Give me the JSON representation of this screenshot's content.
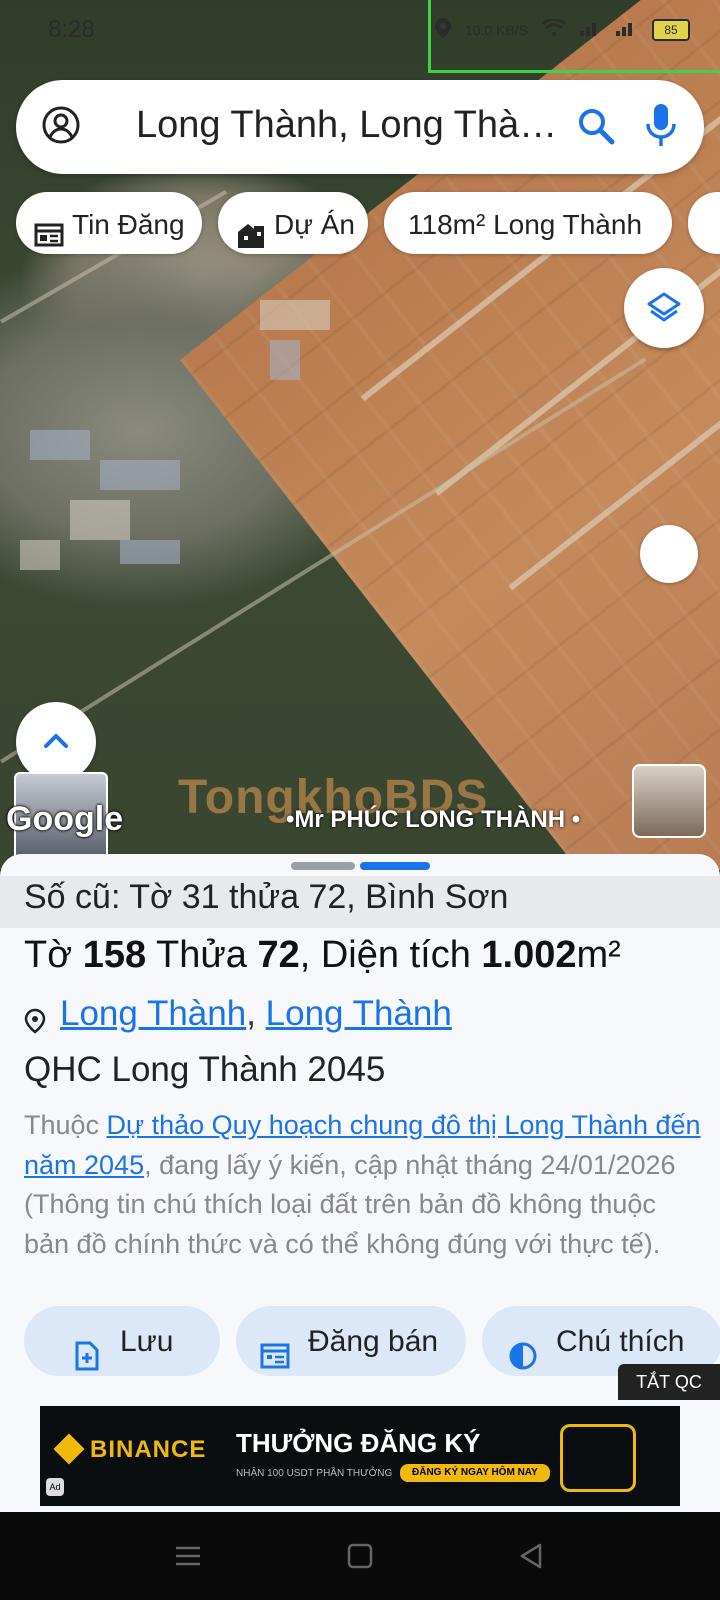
{
  "status": {
    "time": "8:28",
    "speed": "10.0 KB/S",
    "battery": "85"
  },
  "search": {
    "value": "Long Thành, Long Thà…"
  },
  "chips": [
    {
      "label": "Tin Đăng",
      "icon": "news-icon"
    },
    {
      "label": "Dự Án",
      "icon": "building-icon"
    },
    {
      "label": "118m² Long Thành",
      "icon": ""
    }
  ],
  "map": {
    "attribution": "Google",
    "watermark": "TongkhoBDS",
    "banner": "•Mr PHÚC LONG THÀNH •"
  },
  "sheet": {
    "old_number": "Số cũ: Tờ 31 thửa 72, Bình Sơn",
    "parcel": {
      "to_label": "Tờ ",
      "to": "158",
      "thua_label": " Thửa ",
      "thua": "72",
      "dt_label": ", Diện tích ",
      "area": "1.002",
      "unit": "m²"
    },
    "location": {
      "ward": "Long Thành",
      "sep": ", ",
      "district": "Long Thành"
    },
    "plan_name": "QHC Long Thành 2045",
    "desc_prefix": "Thuộc ",
    "desc_link": "Dự thảo Quy hoạch chung đô thị Long Thành đến năm 2045",
    "desc_rest": ", đang lấy ý kiến, cập nhật tháng 24/01/2026 (Thông tin chú thích loại đất trên bản đồ không thuộc bản đồ chính thức và có thể không đúng với thực tế)."
  },
  "actions": {
    "save": "Lưu",
    "post": "Đăng bán",
    "legend": "Chú thích"
  },
  "ad": {
    "close_label": "TẮT QC",
    "brand": "BINANCE",
    "headline": "THƯỞNG ĐĂNG KÝ",
    "subtext": "NHẬN 100 USDT PHẦN THƯỞNG",
    "cta": "ĐĂNG KÝ NGAY HÔM NAY",
    "badge": "Ad"
  },
  "colors": {
    "link": "#1a73e8",
    "chip_active": "#dce8f8",
    "binance": "#f0b90b"
  }
}
